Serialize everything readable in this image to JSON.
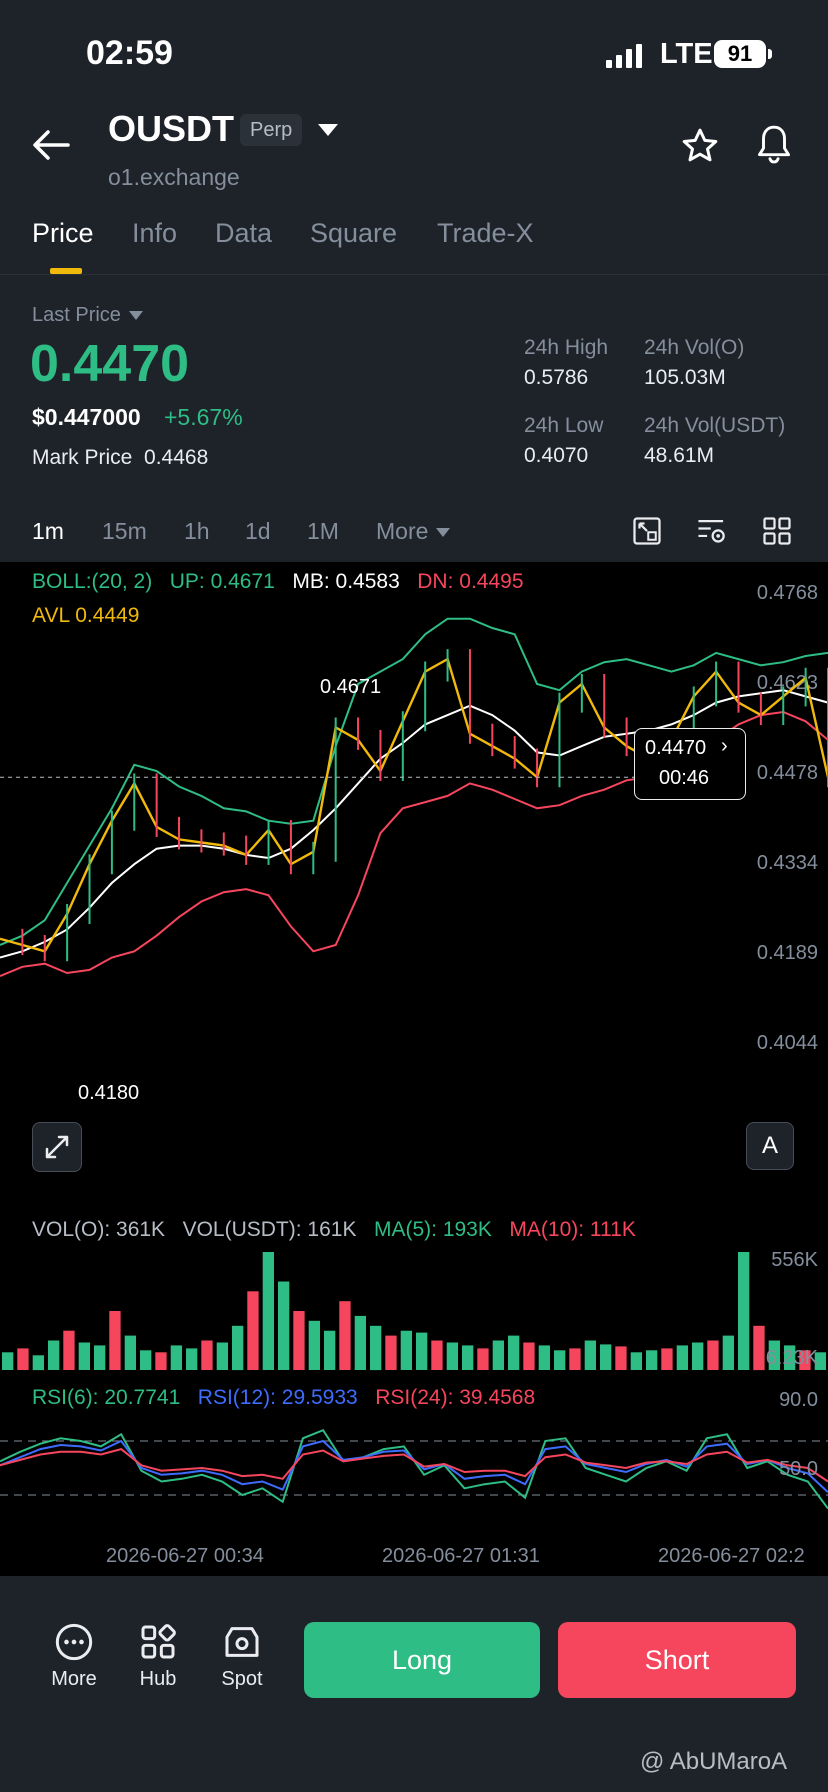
{
  "status": {
    "time": "02:59",
    "network": "LTE",
    "battery": "91"
  },
  "header": {
    "symbol": "OUSDT",
    "badge": "Perp",
    "exchange": "o1.exchange"
  },
  "tabs": [
    "Price",
    "Info",
    "Data",
    "Square",
    "Trade-X"
  ],
  "ticker": {
    "last_label": "Last Price",
    "last_price": "0.4470",
    "usd_price": "$0.447000",
    "change": "+5.67%",
    "mark_label": "Mark Price",
    "mark_value": "0.4468",
    "high_label": "24h High",
    "high_value": "0.5786",
    "low_label": "24h Low",
    "low_value": "0.4070",
    "volo_label": "24h Vol(O)",
    "volo_value": "105.03M",
    "volu_label": "24h Vol(USDT)",
    "volu_value": "48.61M"
  },
  "intervals": [
    "1m",
    "15m",
    "1h",
    "1d",
    "1M",
    "More"
  ],
  "main_legend": {
    "boll": "BOLL:(20, 2)",
    "up": "UP: 0.4671",
    "mb": "MB: 0.4583",
    "dn": "DN: 0.4495",
    "avl": "AVL 0.4449"
  },
  "vol_legend": {
    "volo": "VOL(O): 361K",
    "volu": "VOL(USDT): 161K",
    "ma5": "MA(5): 193K",
    "ma10": "MA(10): 111K"
  },
  "rsi_legend": {
    "r6": "RSI(6): 20.7741",
    "r12": "RSI(12): 29.5933",
    "r24": "RSI(24): 39.4568"
  },
  "chart_labels": {
    "high_marker": "0.4671",
    "low_marker": "0.4180",
    "current_price": "0.4470",
    "countdown": "00:46",
    "auto_button": "A"
  },
  "chart_data": [
    {
      "type": "line",
      "price_axis_ticks": [
        "0.4768",
        "0.4623",
        "0.4478",
        "0.4334",
        "0.4189",
        "0.4044"
      ],
      "ylim": [
        0.4044,
        0.4768
      ],
      "x_ticks": [
        "2026-06-27 00:34",
        "2026-06-27 01:31",
        "2026-06-27 02:2"
      ],
      "series": [
        {
          "name": "UP",
          "values": [
            0.42,
            0.4215,
            0.424,
            0.43,
            0.436,
            0.442,
            0.449,
            0.448,
            0.4455,
            0.444,
            0.442,
            0.4415,
            0.44,
            0.4395,
            0.44,
            0.452,
            0.462,
            0.464,
            0.466,
            0.47,
            0.4725,
            0.4725,
            0.471,
            0.47,
            0.462,
            0.461,
            0.464,
            0.4655,
            0.466,
            0.465,
            0.464,
            0.465,
            0.467,
            0.466,
            0.465,
            0.4655,
            0.4665,
            0.467
          ]
        },
        {
          "name": "MB",
          "values": [
            0.418,
            0.419,
            0.4205,
            0.4225,
            0.426,
            0.43,
            0.433,
            0.4355,
            0.436,
            0.436,
            0.4355,
            0.4345,
            0.434,
            0.4355,
            0.4385,
            0.442,
            0.446,
            0.45,
            0.4525,
            0.4555,
            0.457,
            0.4585,
            0.457,
            0.4545,
            0.451,
            0.4505,
            0.452,
            0.4535,
            0.454,
            0.4545,
            0.4555,
            0.457,
            0.459,
            0.46,
            0.4605,
            0.461,
            0.46,
            0.459
          ]
        },
        {
          "name": "DN",
          "values": [
            0.415,
            0.4165,
            0.417,
            0.4155,
            0.416,
            0.418,
            0.419,
            0.4215,
            0.4245,
            0.427,
            0.4285,
            0.429,
            0.428,
            0.423,
            0.419,
            0.42,
            0.428,
            0.438,
            0.442,
            0.443,
            0.444,
            0.446,
            0.445,
            0.4435,
            0.442,
            0.4425,
            0.444,
            0.445,
            0.4465,
            0.447,
            0.448,
            0.451,
            0.453,
            0.4555,
            0.457,
            0.4575,
            0.456,
            0.453
          ]
        },
        {
          "name": "Price",
          "values": [
            0.421,
            0.42,
            0.419,
            0.425,
            0.433,
            0.44,
            0.446,
            0.439,
            0.437,
            0.4365,
            0.436,
            0.4345,
            0.4385,
            0.433,
            0.435,
            0.455,
            0.453,
            0.448,
            0.456,
            0.464,
            0.466,
            0.454,
            0.452,
            0.45,
            0.447,
            0.459,
            0.462,
            0.455,
            0.452,
            0.45,
            0.453,
            0.46,
            0.464,
            0.459,
            0.457,
            0.46,
            0.463,
            0.447
          ]
        }
      ]
    },
    {
      "type": "bar",
      "name": "volume",
      "axis_ticks": [
        "556K",
        "6.23K"
      ],
      "values": [
        18,
        22,
        15,
        30,
        40,
        28,
        25,
        60,
        35,
        20,
        18,
        25,
        22,
        30,
        28,
        45,
        80,
        120,
        90,
        60,
        50,
        40,
        70,
        55,
        45,
        35,
        40,
        38,
        30,
        28,
        25,
        22,
        30,
        35,
        28,
        25,
        20,
        22,
        30,
        26,
        24,
        18,
        20,
        22,
        25,
        28,
        30,
        35,
        120,
        45,
        30,
        25,
        20,
        18
      ]
    },
    {
      "type": "line",
      "name": "RSI",
      "axis_ticks": [
        "90.0",
        "50.0"
      ],
      "ylim": [
        10,
        90
      ],
      "series": [
        {
          "name": "RSI(6)",
          "values": [
            55,
            62,
            68,
            72,
            70,
            66,
            75,
            48,
            40,
            42,
            45,
            40,
            30,
            35,
            25,
            72,
            78,
            55,
            58,
            64,
            66,
            45,
            52,
            35,
            38,
            40,
            28,
            70,
            72,
            50,
            45,
            40,
            50,
            55,
            48,
            72,
            75,
            50,
            55,
            45,
            40,
            20
          ]
        },
        {
          "name": "RSI(12)",
          "values": [
            52,
            58,
            64,
            67,
            66,
            63,
            70,
            50,
            45,
            46,
            48,
            45,
            38,
            40,
            34,
            66,
            70,
            56,
            58,
            62,
            63,
            49,
            53,
            42,
            44,
            45,
            38,
            64,
            66,
            53,
            50,
            47,
            53,
            56,
            51,
            66,
            68,
            53,
            56,
            50,
            46,
            32
          ]
        },
        {
          "name": "RSI(24)",
          "values": [
            52,
            56,
            60,
            62,
            62,
            60,
            64,
            52,
            48,
            49,
            50,
            48,
            44,
            45,
            42,
            60,
            63,
            55,
            57,
            59,
            60,
            51,
            53,
            47,
            48,
            48,
            44,
            58,
            60,
            54,
            52,
            50,
            54,
            55,
            53,
            60,
            62,
            54,
            56,
            52,
            50,
            40
          ]
        }
      ]
    }
  ],
  "bottom": {
    "more": "More",
    "hub": "Hub",
    "spot": "Spot",
    "long": "Long",
    "short": "Short"
  },
  "watermark": "@ AbUMaroA",
  "colors": {
    "green": "#2ebd85",
    "red": "#f6465d",
    "yellow": "#f0b90b",
    "blue": "#3d6cff",
    "bg": "#1e2329"
  }
}
